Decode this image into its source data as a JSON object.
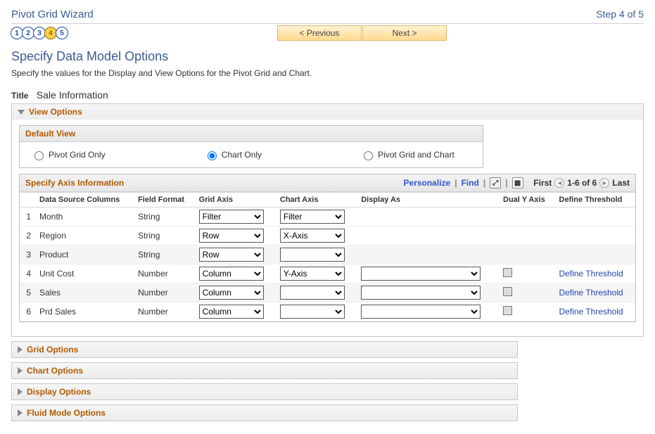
{
  "header": {
    "wizard_title": "Pivot Grid Wizard",
    "step_text": "Step 4 of 5"
  },
  "steps": [
    "1",
    "2",
    "3",
    "4",
    "5"
  ],
  "active_step_index": 3,
  "nav": {
    "prev": "< Previous",
    "next": "Next >"
  },
  "page": {
    "title": "Specify Data Model Options",
    "desc": "Specify the values for the Display and View Options for the Pivot Grid and Chart."
  },
  "title_row": {
    "label": "Title",
    "value": "Sale Information"
  },
  "sections": {
    "view_options": "View Options",
    "grid_options": "Grid Options",
    "chart_options": "Chart Options",
    "display_options": "Display Options",
    "fluid_mode_options": "Fluid Mode Options"
  },
  "default_view": {
    "header": "Default View",
    "options": {
      "pivot_only": "Pivot Grid Only",
      "chart_only": "Chart Only",
      "both": "Pivot Grid and Chart"
    },
    "selected": "chart_only"
  },
  "axis": {
    "header": "Specify Axis Information",
    "toolbar": {
      "personalize": "Personalize",
      "find": "Find",
      "first": "First",
      "range": "1-6 of 6",
      "last": "Last"
    },
    "columns": {
      "num": "",
      "data_source": "Data Source Columns",
      "field_format": "Field Format",
      "grid_axis": "Grid Axis",
      "chart_axis": "Chart Axis",
      "display_as": "Display As",
      "dual_y": "Dual Y Axis",
      "define_threshold": "Define Threshold"
    },
    "rows": [
      {
        "n": "1",
        "name": "Month",
        "fmt": "String",
        "grid": "Filter",
        "chart": "Filter",
        "display": null,
        "dual": null,
        "thresh": null
      },
      {
        "n": "2",
        "name": "Region",
        "fmt": "String",
        "grid": "Row",
        "chart": "X-Axis",
        "display": null,
        "dual": null,
        "thresh": null
      },
      {
        "n": "3",
        "name": "Product",
        "fmt": "String",
        "grid": "Row",
        "chart": "",
        "display": null,
        "dual": null,
        "thresh": null
      },
      {
        "n": "4",
        "name": "Unit Cost",
        "fmt": "Number",
        "grid": "Column",
        "chart": "Y-Axis",
        "display": "",
        "dual": false,
        "thresh": "Define Threshold"
      },
      {
        "n": "5",
        "name": "Sales",
        "fmt": "Number",
        "grid": "Column",
        "chart": "",
        "display": "",
        "dual": false,
        "thresh": "Define Threshold"
      },
      {
        "n": "6",
        "name": "Prd Sales",
        "fmt": "Number",
        "grid": "Column",
        "chart": "",
        "display": "",
        "dual": false,
        "thresh": "Define Threshold"
      }
    ],
    "grid_axis_options": [
      "Filter",
      "Row",
      "Column"
    ],
    "chart_axis_options": [
      "",
      "Filter",
      "X-Axis",
      "Y-Axis"
    ],
    "display_as_options": [
      ""
    ]
  }
}
